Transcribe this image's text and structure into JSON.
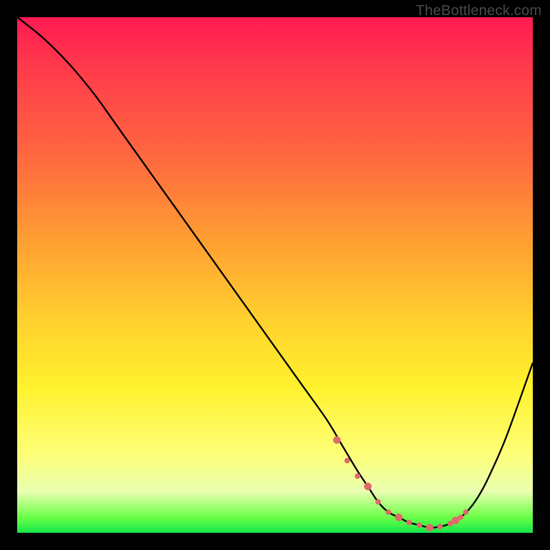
{
  "watermark": "TheBottleneck.com",
  "colors": {
    "frame": "#000000",
    "gradient_top": "#ff1a52",
    "gradient_mid": "#ffcf2e",
    "gradient_bottom": "#14e84a",
    "curve": "#000000",
    "dots": "#de6a6a"
  },
  "chart_data": {
    "type": "line",
    "title": "",
    "xlabel": "",
    "ylabel": "",
    "xlim": [
      0,
      100
    ],
    "ylim": [
      0,
      100
    ],
    "grid": false,
    "legend": false,
    "annotations": [
      "TheBottleneck.com"
    ],
    "series": [
      {
        "name": "bottleneck-curve",
        "x": [
          0,
          5,
          10,
          15,
          20,
          25,
          30,
          35,
          40,
          45,
          50,
          55,
          60,
          63,
          66,
          68,
          70,
          72,
          74,
          76,
          78,
          80,
          82,
          84,
          86,
          88,
          90,
          92,
          95,
          100
        ],
        "values": [
          100,
          96,
          91,
          85,
          78,
          71,
          64,
          57,
          50,
          43,
          36,
          29,
          22,
          17,
          12,
          9,
          6,
          4,
          3,
          2,
          1.5,
          1,
          1.2,
          1.8,
          3,
          5,
          8,
          12,
          19,
          33
        ]
      }
    ],
    "highlight_dots": {
      "name": "optimal-range",
      "x": [
        62,
        64,
        66,
        68,
        70,
        72,
        74,
        76,
        78,
        80,
        82,
        84,
        85,
        86,
        87
      ],
      "values": [
        18,
        14,
        11,
        9,
        6,
        4,
        3,
        2,
        1.5,
        1,
        1.2,
        1.8,
        2.4,
        3,
        4
      ]
    }
  }
}
